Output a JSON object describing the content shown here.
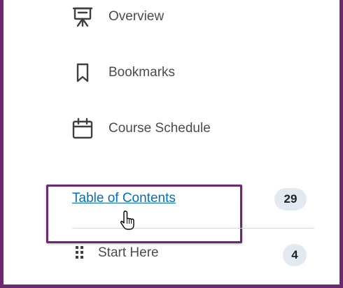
{
  "nav": {
    "items": [
      {
        "label": "Overview",
        "icon": "presentation-board-icon"
      },
      {
        "label": "Bookmarks",
        "icon": "bookmark-icon"
      },
      {
        "label": "Course Schedule",
        "icon": "calendar-icon"
      }
    ]
  },
  "toc": {
    "label": "Table of Contents",
    "count": "29"
  },
  "modules": [
    {
      "label": "Start Here",
      "count": "4"
    }
  ],
  "colors": {
    "frame": "#6b2a6f",
    "link": "#006fbf",
    "badge_bg": "#e3e9f1"
  }
}
